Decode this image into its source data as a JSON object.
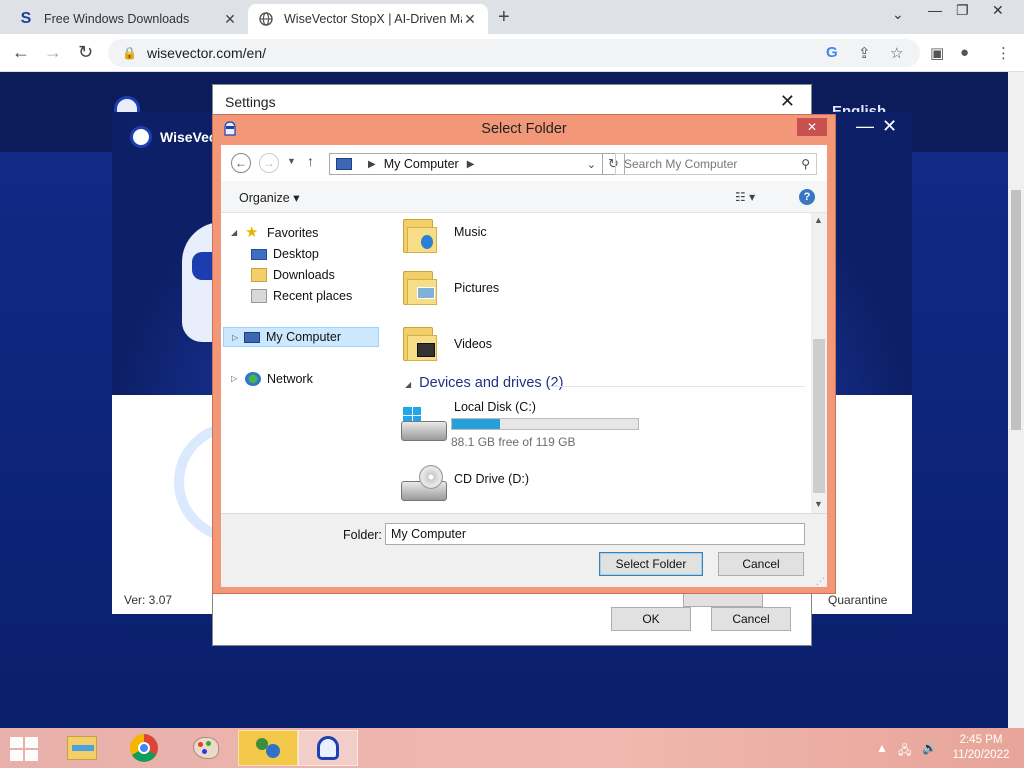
{
  "browser": {
    "tabs": [
      {
        "title": "Free Windows Downloads",
        "favicon": "S"
      },
      {
        "title": "WiseVector StopX | AI-Driven Ma"
      }
    ],
    "url": "wisevector.com/en/"
  },
  "page": {
    "language": "English",
    "accent": "#0c1b5a"
  },
  "app": {
    "brand": "WiseVec",
    "version": "Ver: 3.07",
    "quarantine": "Quarantine"
  },
  "settings": {
    "title": "Settings",
    "ok": "OK",
    "cancel": "Cancel"
  },
  "select_folder": {
    "title": "Select Folder",
    "breadcrumb": "My Computer",
    "search_placeholder": "Search My Computer",
    "organize": "Organize",
    "nav": {
      "favorites": "Favorites",
      "desktop": "Desktop",
      "downloads": "Downloads",
      "recent": "Recent places",
      "my_computer": "My Computer",
      "network": "Network"
    },
    "folders": [
      "Music",
      "Pictures",
      "Videos"
    ],
    "devices_header": "Devices and drives (2)",
    "drives": [
      {
        "name": "Local Disk (C:)",
        "free_text": "88.1 GB free of 119 GB",
        "used_fraction": 0.26
      },
      {
        "name": "CD Drive (D:)"
      }
    ],
    "folder_label": "Folder:",
    "folder_value": "My Computer",
    "select_button": "Select Folder",
    "cancel_button": "Cancel"
  },
  "taskbar": {
    "time": "2:45 PM",
    "date": "11/20/2022"
  }
}
